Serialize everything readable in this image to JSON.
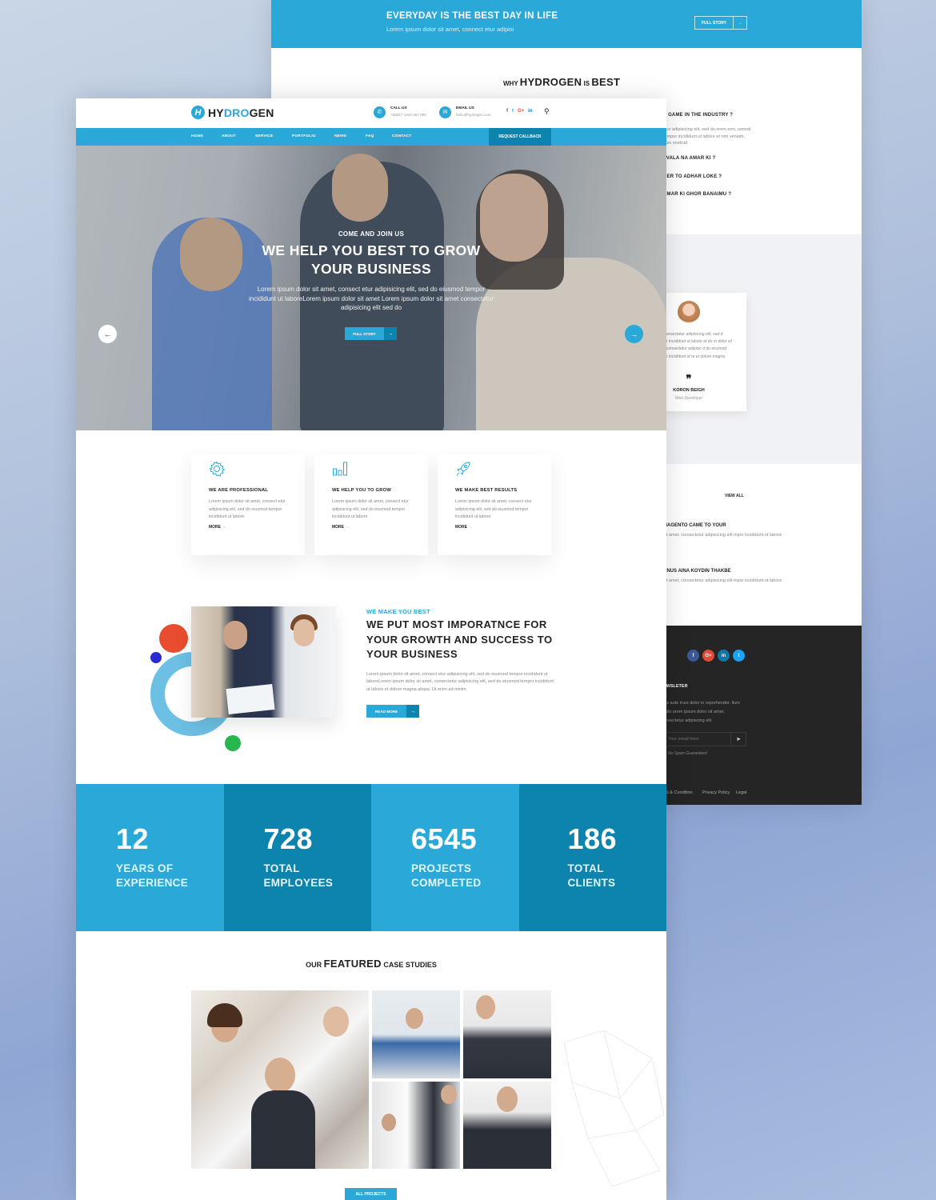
{
  "back_page": {
    "banner": {
      "title": "EVERYDAY IS THE BEST DAY IN LIFE",
      "subtitle": "Lorem ipsum dolor sit amet, connect etur adipisi",
      "button_label": "FULL STORY",
      "button_icon": "arrow-right-icon"
    },
    "why_heading": {
      "prefix": "WHY",
      "brand": "HYDROGEN",
      "mid": "IS",
      "suffix": "BEST"
    },
    "faq": [
      {
        "question": "E GAME IN THE INDUSTRY ?",
        "answer": "etur adipisicing elit, sed do.orem erm, usmod tempor incididunt ut labore et nim veniam, quis nostrud"
      },
      {
        "question": "I VALA NA AMAR KI ?"
      },
      {
        "question": "NER TO ADHAR LOKE ?"
      },
      {
        "question": "AMAR KI GHOR BANAIMU ?"
      }
    ],
    "testimonial": {
      "text": "met, consectetur adipisicing elit, sed d tempor incididunt ut labore et do m dolor sit amet, consectetur adipisic d do eiusmod tempor incididunt ut re et dolore magna aliqua.",
      "quote_icon": "quote-icon",
      "name": "KORON BEIGH",
      "role": "Web Developer"
    },
    "news": {
      "view_all": "VIEW ALL",
      "items": [
        {
          "title": "MAGENTO CAME TO YOUR",
          "excerpt": "sit amet, consectetur adipisicing elit mpor incididunt ut labore"
        },
        {
          "title": "ANUS AINA KOYDIN THAKBE",
          "excerpt": "sit amet, consectetur adipisicing elit mpor incididunt ut labore"
        }
      ]
    },
    "footer": {
      "social": [
        {
          "icon": "facebook-icon",
          "glyph": "f",
          "color": "#3b5998"
        },
        {
          "icon": "google-plus-icon",
          "glyph": "G+",
          "color": "#dd4b39"
        },
        {
          "icon": "linkedin-icon",
          "glyph": "in",
          "color": "#0e76a8"
        },
        {
          "icon": "twitter-icon",
          "glyph": "t",
          "color": "#1da1f2"
        }
      ],
      "newsletter_title": "EWSLETER",
      "newsletter_text": "uis aute irure dolor in reprehender. llum dolo orem ipsum dolor sit amet, onsectetur adipiscing elit",
      "email_placeholder": "Your email here",
      "send_icon": "paper-plane-icon",
      "no_spam": "No Spam Guaranteed",
      "links": [
        "s & Condition",
        "Privacy Policy",
        "Legal"
      ]
    }
  },
  "front_page": {
    "header": {
      "logo_icon": "H",
      "logo_part1": "HY",
      "logo_part2": "DRO",
      "logo_part3": "GEN",
      "call_label": "CALL US",
      "call_value": "+88017 1234 567 890",
      "email_label": "EMAIL US",
      "email_value": "hello@hydrogen.com",
      "social": [
        {
          "icon": "facebook-icon",
          "glyph": "f",
          "color": "#3b5998"
        },
        {
          "icon": "twitter-icon",
          "glyph": "t",
          "color": "#1da1f2"
        },
        {
          "icon": "google-plus-icon",
          "glyph": "G+",
          "color": "#dd4b39"
        },
        {
          "icon": "linkedin-icon",
          "glyph": "in",
          "color": "#0e76a8"
        }
      ],
      "search_icon": "search-icon"
    },
    "nav": {
      "items": [
        "HOME",
        "ABOUT",
        "SERVICE",
        "PORTFOLIO",
        "NEWS",
        "FAQ",
        "CONTACT"
      ],
      "cta": "REQUEST CALLBACK"
    },
    "hero": {
      "subtitle": "COME AND JOIN US",
      "title_line1": "WE HELP YOU BEST TO GROW",
      "title_line2": "YOUR BUSINESS",
      "description": "Lorem ipsum dolor sit amet, consect etur adipisicing elit, sed do eiusmod tempor incididunt ut laboreLorem ipsum dolor sit amet Lorem ipsum dolor sit amet consectetur adipisicing elit sed do",
      "button_label": "FULL STORY",
      "prev_icon": "arrow-left-icon",
      "next_icon": "arrow-right-icon"
    },
    "features": [
      {
        "icon": "gear-icon",
        "title": "WE ARE PROFESSIONAL",
        "text": "Lorem ipsum dolor sit amet, consect etur adipisicing elit, sed do eiusmod tempor incididunt ut labore",
        "more": "MORE"
      },
      {
        "icon": "bar-chart-icon",
        "title": "WE HELP YOU TO GROW",
        "text": "Lorem ipsum dolor sit amet, consect etur adipisicing elit, sed do eiusmod tempor incididunt ut labore",
        "more": "MORE"
      },
      {
        "icon": "rocket-icon",
        "title": "WE MAKE BEST RESULTS",
        "text": "Lorem ipsum dolor sit amet, consect etur adipisicing elit, sed do eiusmod tempor incididunt ut labore",
        "more": "MORE"
      }
    ],
    "about": {
      "subtitle": "WE MAKE YOU BEST",
      "title": "WE PUT MOST IMPORATNCE FOR YOUR GROWTH AND SUCCESS TO YOUR BUSINESS",
      "text": "Lorem ipsum dolor sit amet, consect etur adipisicing elit, sed do eiusmod tempor incididunt ut laboreLorem ipsum dolor sit amet, consectetur adipisicing elit, sed do eiusmod tempor incididunt ut labore et dolore magna aliqua. Ut enim ad minim",
      "button_label": "READ MORE"
    },
    "stats": [
      {
        "value": "12",
        "label_line1": "YEARS OF",
        "label_line2": "EXPERIENCE",
        "color": "#2aa9d8"
      },
      {
        "value": "728",
        "label_line1": "TOTAL",
        "label_line2": "EMPLOYEES",
        "color": "#0d84ad"
      },
      {
        "value": "6545",
        "label_line1": "PROJECTS",
        "label_line2": "COMPLETED",
        "color": "#2aa9d8"
      },
      {
        "value": "186",
        "label_line1": "TOTAL",
        "label_line2": "CLIENTS",
        "color": "#0d84ad"
      }
    ],
    "case_studies": {
      "title_prefix": "OUR",
      "title_bold": "FEATURED",
      "title_suffix": "CASE STUDIES",
      "button_label": "ALL PROJECTS"
    }
  },
  "colors": {
    "primary": "#2aa9d8",
    "primary_dark": "#0d84ad",
    "dark_footer": "#252525"
  }
}
